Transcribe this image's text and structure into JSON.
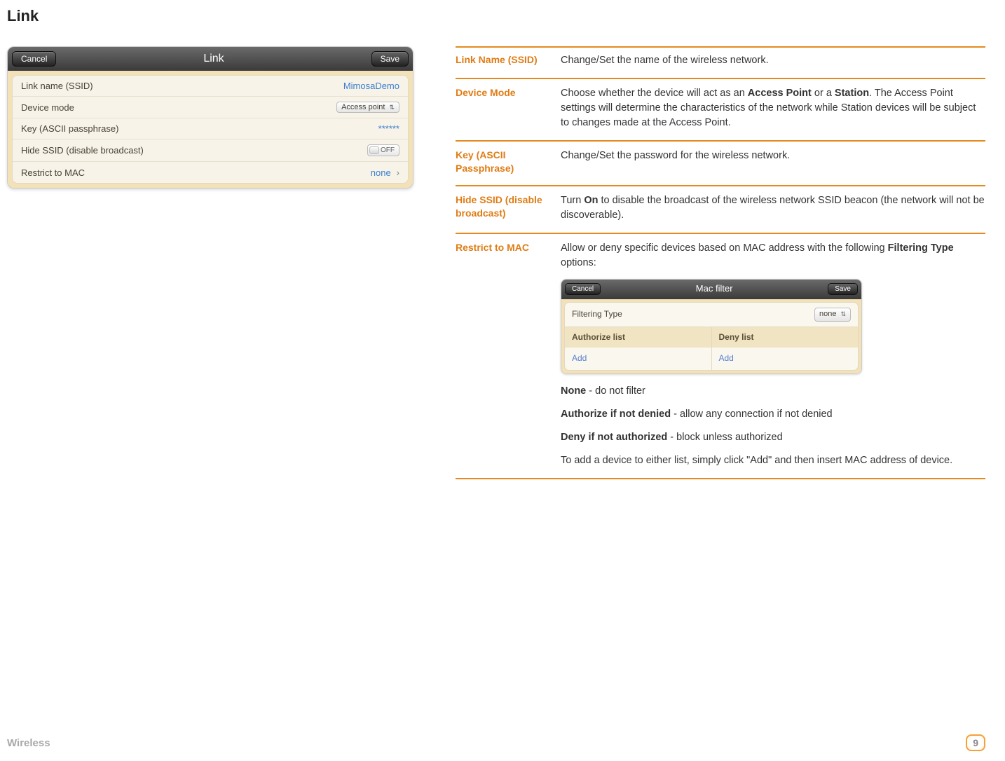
{
  "page": {
    "title": "Link",
    "footer_section": "Wireless",
    "page_number": "9"
  },
  "link_window": {
    "cancel": "Cancel",
    "title": "Link",
    "save": "Save",
    "rows": {
      "ssid_label": "Link name (SSID)",
      "ssid_value": "MimosaDemo",
      "mode_label": "Device mode",
      "mode_value": "Access point",
      "key_label": "Key (ASCII passphrase)",
      "key_value": "******",
      "hide_label": "Hide SSID (disable broadcast)",
      "hide_value": "OFF",
      "mac_label": "Restrict to MAC",
      "mac_value": "none"
    }
  },
  "definitions": {
    "link_name": {
      "term": "Link Name (SSID)",
      "desc": "Change/Set the name of the wireless network."
    },
    "device_mode": {
      "term": "Device Mode",
      "desc_pre": "Choose whether the device will act as an ",
      "bold1": "Access Point",
      "mid1": " or a ",
      "bold2": "Station",
      "desc_post": ". The Access Point settings will determine the characteristics of the network while Station devices will be subject to changes made at the Access Point."
    },
    "key": {
      "term": "Key (ASCII Passphrase)",
      "desc": "Change/Set the password for the wireless network."
    },
    "hide_ssid": {
      "term": "Hide SSID (disable broadcast)",
      "desc_pre": "Turn ",
      "bold1": "On",
      "desc_post": " to disable the broadcast of the wireless network SSID beacon (the network will not be discoverable)."
    },
    "restrict_mac": {
      "term": "Restrict to MAC",
      "intro_pre": "Allow or deny specific devices based on MAC address with the following ",
      "intro_bold": "Filtering Type",
      "intro_post": " options:",
      "opt_none_b": "None",
      "opt_none_t": " - do not filter",
      "opt_auth_b": "Authorize if not denied",
      "opt_auth_t": " - allow any connection if not denied",
      "opt_deny_b": "Deny if not authorized",
      "opt_deny_t": " - block unless authorized",
      "tail": "To add a device to either list, simply click \"Add\" and then insert MAC address of device."
    }
  },
  "mac_window": {
    "cancel": "Cancel",
    "title": "Mac filter",
    "save": "Save",
    "filtering_label": "Filtering Type",
    "filtering_value": "none",
    "auth_header": "Authorize list",
    "deny_header": "Deny list",
    "auth_add": "Add",
    "deny_add": "Add"
  }
}
